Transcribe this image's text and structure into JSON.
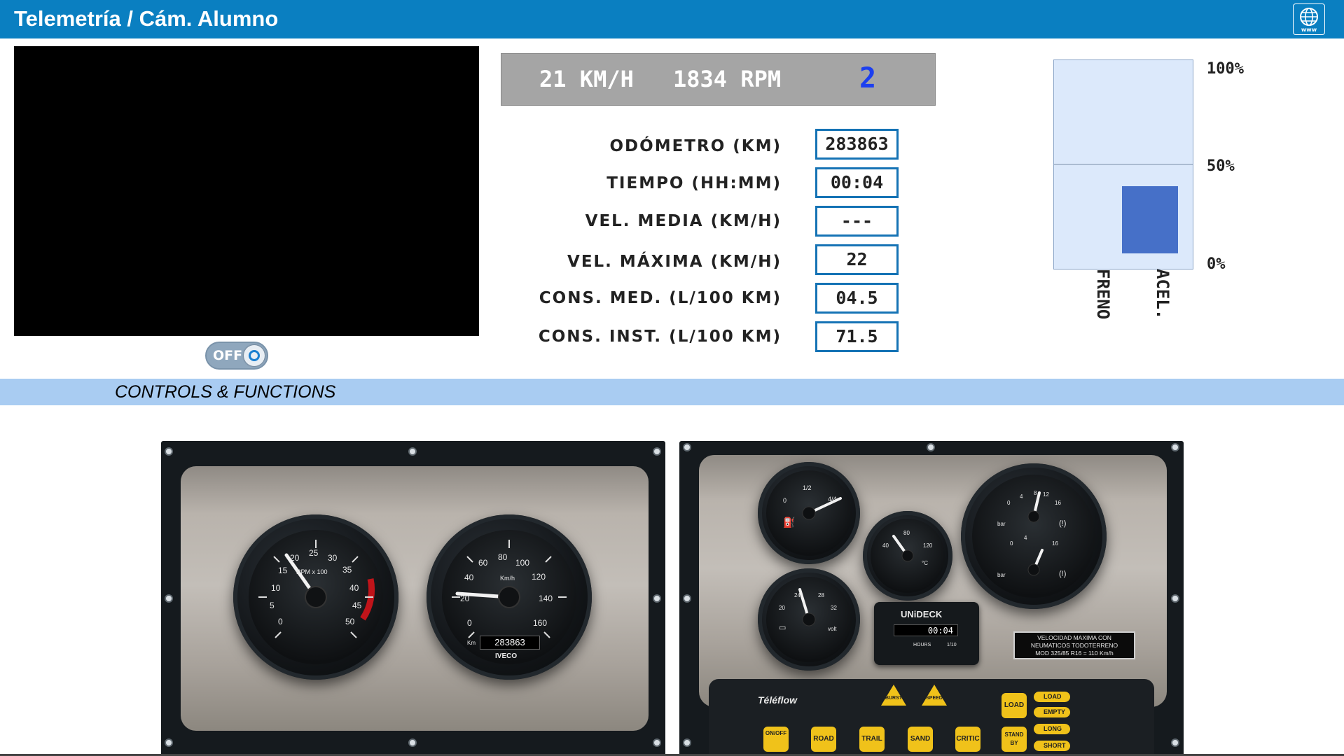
{
  "header": {
    "title": "Telemetría / Cám. Alumno",
    "web_label": "www"
  },
  "camera": {
    "toggle_label": "OFF"
  },
  "speedbar": {
    "speed": "21 KM/H",
    "rpm": "1834 RPM",
    "gear": "2"
  },
  "stats": [
    {
      "label": "ODÓMETRO (KM)",
      "value": "283863"
    },
    {
      "label": "TIEMPO (HH:MM)",
      "value": "00:04"
    },
    {
      "label": "VEL. MEDIA (KM/H)",
      "value": "---"
    },
    {
      "label": "VEL. MÁXIMA (KM/H)",
      "value": "22"
    },
    {
      "label": "CONS. MED. (L/100 KM)",
      "value": "04.5"
    },
    {
      "label": "CONS. INST. (L/100 KM)",
      "value": "71.5"
    }
  ],
  "pedals": {
    "ticks": [
      "100%",
      "50%",
      "0%"
    ],
    "freno_label": "FRENO",
    "acel_label": "ACEL.",
    "freno_percent": 0,
    "acel_percent": 35,
    "color": "#4670c8"
  },
  "section": {
    "title": "CONTROLS & FUNCTIONS"
  },
  "dashboard": {
    "tach": {
      "unit": "RPM x 100",
      "ticks": [
        "0",
        "5",
        "10",
        "15",
        "20",
        "25",
        "30",
        "35",
        "40",
        "45",
        "50"
      ]
    },
    "speedo": {
      "unit": "Km/h",
      "ticks": [
        "0",
        "20",
        "40",
        "60",
        "80",
        "100",
        "120",
        "140",
        "160"
      ],
      "odo_label": "Km",
      "odometer": "283863",
      "brand": "IVECO"
    },
    "fuel": {
      "ticks": [
        "0",
        "1/2",
        "4/4"
      ]
    },
    "temp": {
      "ticks": [
        "40",
        "80",
        "120"
      ],
      "unit": "°C"
    },
    "volt": {
      "ticks": [
        "20",
        "24",
        "28",
        "32"
      ],
      "unit": "volt"
    },
    "pressure": {
      "ticks": [
        "0",
        "4",
        "8",
        "12",
        "16"
      ],
      "unit": "bar"
    },
    "hours": {
      "brand": "UNiDECK",
      "value": "00:04",
      "label": "HOURS",
      "scale": "1/10"
    },
    "plate_lines": [
      "VELOCIDAD MAXIMA CON",
      "NEUMATICOS TODOTERRENO",
      "MOD 325/85 R16 = 110 Km/h"
    ],
    "teleflow": {
      "brand": "Téléflow",
      "warnings": [
        "BURST",
        "SPEED"
      ],
      "buttons": [
        "ON/OFF",
        "ROAD",
        "TRAIL",
        "SAND",
        "CRITIC",
        "LOAD",
        "STAND BY"
      ],
      "pills": [
        "LOAD",
        "EMPTY",
        "LONG",
        "SHORT"
      ]
    }
  }
}
